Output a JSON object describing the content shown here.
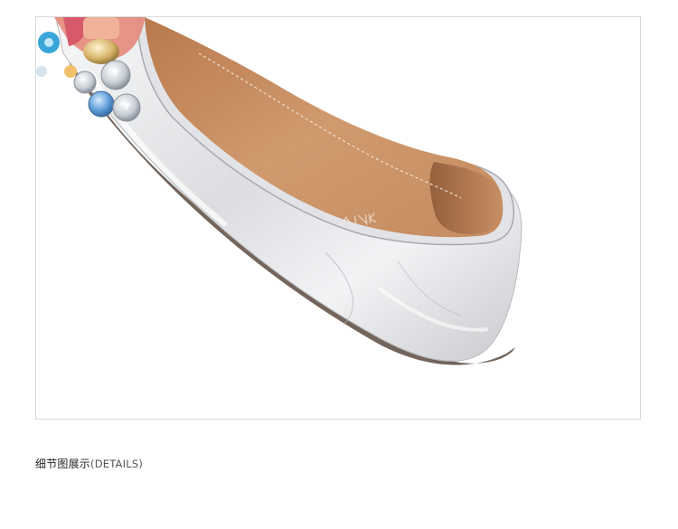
{
  "caption": {
    "title_cn": "细节图展示",
    "title_en": "(DETAILS)"
  },
  "product_photo": {
    "subject": "shoe-detail-photo",
    "colors": {
      "background": "#ffffff",
      "frame_border": "#d9d9d9",
      "upper_silver": "#e9eaec",
      "insole_tan": "#c98e60",
      "lining_brown": "#a36b45"
    }
  }
}
